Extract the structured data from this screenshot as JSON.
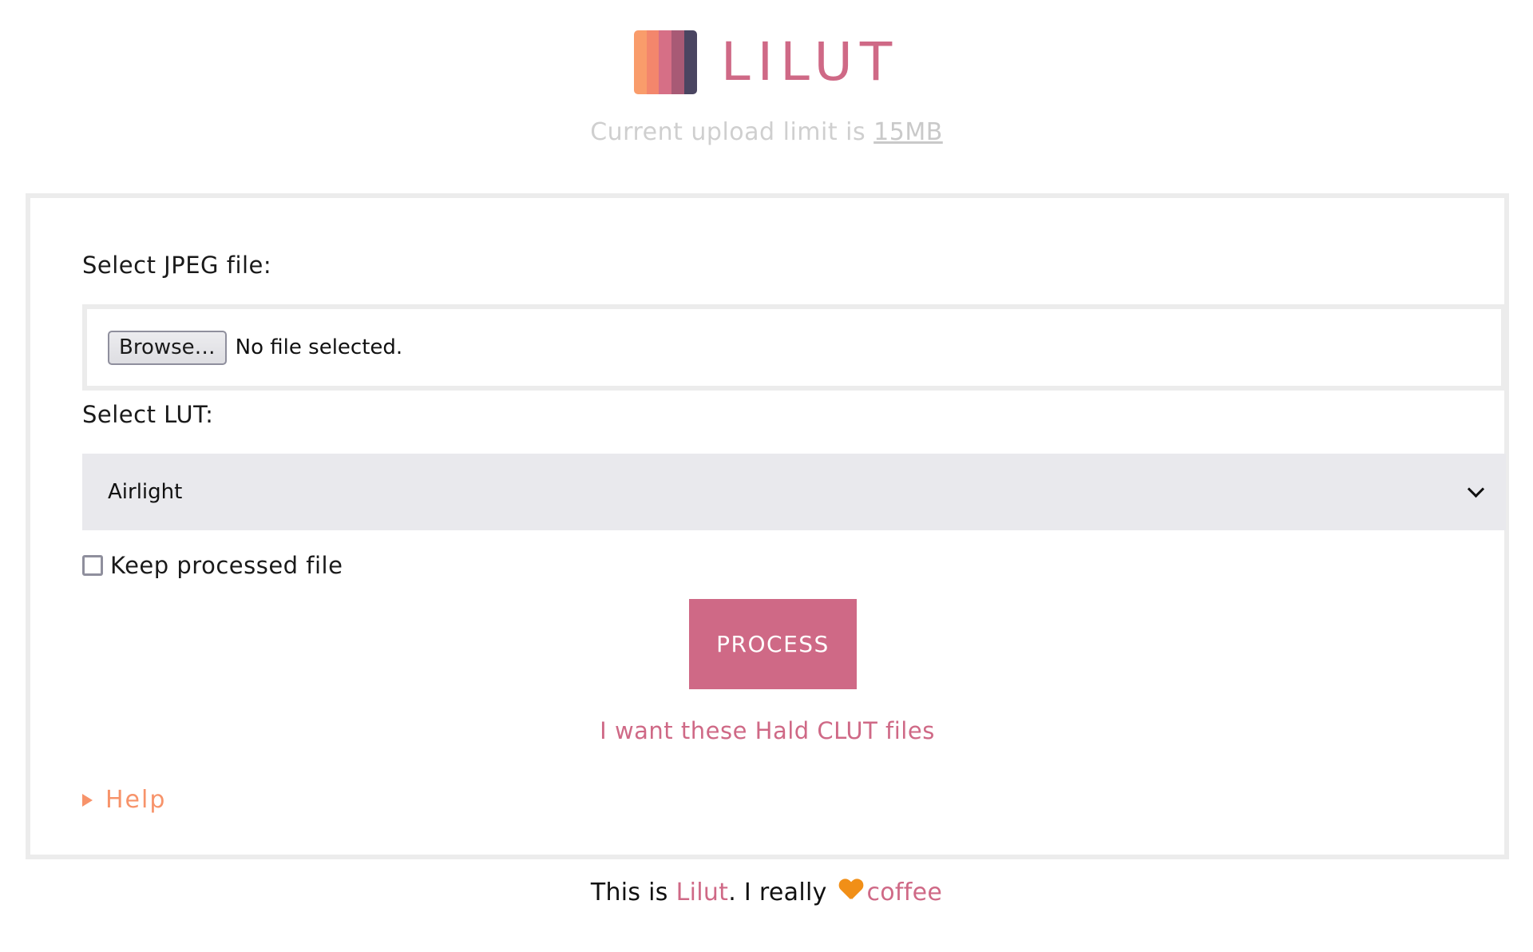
{
  "header": {
    "brand": "LILUT",
    "logo_colors": [
      "#f99c6b",
      "#f3866c",
      "#d66f86",
      "#a85a75",
      "#4a4561"
    ],
    "upload_limit_prefix": "Current upload limit is ",
    "upload_limit_value": "15MB"
  },
  "form": {
    "file_label": "Select JPEG file:",
    "browse_label": "Browse…",
    "file_status": "No file selected.",
    "lut_label": "Select LUT:",
    "lut_selected": "Airlight",
    "keep_label": "Keep processed file",
    "keep_checked": false,
    "process_label": "PROCESS",
    "clut_link": "I want these Hald CLUT files",
    "help_label": "Help"
  },
  "footer": {
    "prefix": "This is ",
    "brand_link": "Lilut",
    "middle": ". I really ",
    "coffee_link": "coffee"
  },
  "colors": {
    "brand": "#cf6986",
    "accent_orange": "#f7936a",
    "heart": "#f18f17",
    "muted": "#cfcfcf"
  }
}
